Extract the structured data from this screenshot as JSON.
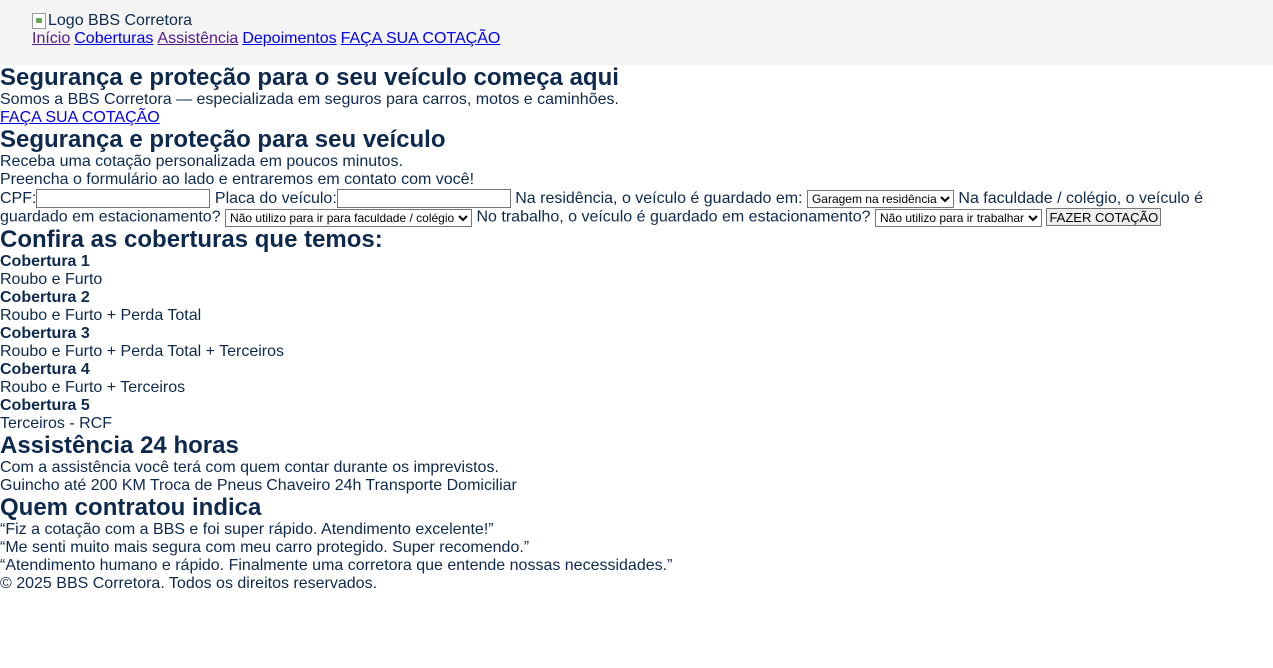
{
  "header": {
    "logo_alt": "Logo BBS Corretora",
    "nav": {
      "inicio": "Início",
      "coberturas": "Coberturas",
      "assistencia": "Assistência",
      "depoimentos": "Depoimentos",
      "cotacao": "FAÇA SUA COTAÇÃO"
    }
  },
  "hero": {
    "title": "Segurança e proteção para o seu veículo começa aqui",
    "subtitle": "Somos a BBS Corretora — especializada em seguros para carros, motos e caminhões.",
    "cta": "FAÇA SUA COTAÇÃO"
  },
  "quote": {
    "title": "Segurança e proteção para seu veículo",
    "line1": "Receba uma cotação personalizada em poucos minutos.",
    "line2": "Preencha o formulário ao lado e entraremos em contato com você!",
    "form": {
      "cpf_label": "CPF:",
      "cpf_value": "",
      "plate_label": "Placa do veículo:",
      "plate_value": "",
      "residence_label": "Na residência, o veículo é guardado em:",
      "residence_selected": "Garagem na residência",
      "school_label": "Na faculdade / colégio, o veículo é guardado em estacionamento?",
      "school_selected": "Não utilizo para ir para faculdade / colégio",
      "work_label": "No trabalho, o veículo é guardado em estacionamento?",
      "work_selected": "Não utilizo para ir trabalhar",
      "submit": "FAZER COTAÇÃO"
    }
  },
  "coverages": {
    "title": "Confira as coberturas que temos:",
    "items": [
      {
        "name": "Cobertura 1",
        "desc": "Roubo e Furto"
      },
      {
        "name": "Cobertura 2",
        "desc": "Roubo e Furto + Perda Total"
      },
      {
        "name": "Cobertura 3",
        "desc": "Roubo e Furto + Perda Total + Terceiros"
      },
      {
        "name": "Cobertura 4",
        "desc": "Roubo e Furto + Terceiros"
      },
      {
        "name": "Cobertura 5",
        "desc": "Terceiros - RCF"
      }
    ]
  },
  "assistance": {
    "title": "Assistência 24 horas",
    "text": "Com a assistência você terá com quem contar durante os imprevistos.",
    "items": [
      "Guincho até 200 KM",
      "Troca de Pneus",
      "Chaveiro 24h",
      "Transporte Domiciliar"
    ]
  },
  "testimonials": {
    "title": "Quem contratou indica",
    "items": [
      "“Fiz a cotação com a BBS e foi super rápido. Atendimento excelente!”",
      "“Me senti muito mais segura com meu carro protegido. Super recomendo.”",
      "“Atendimento humano e rápido. Finalmente uma corretora que entende nossas necessidades.”"
    ]
  },
  "footer": {
    "text": "© 2025 BBS Corretora. Todos os direitos reservados."
  }
}
